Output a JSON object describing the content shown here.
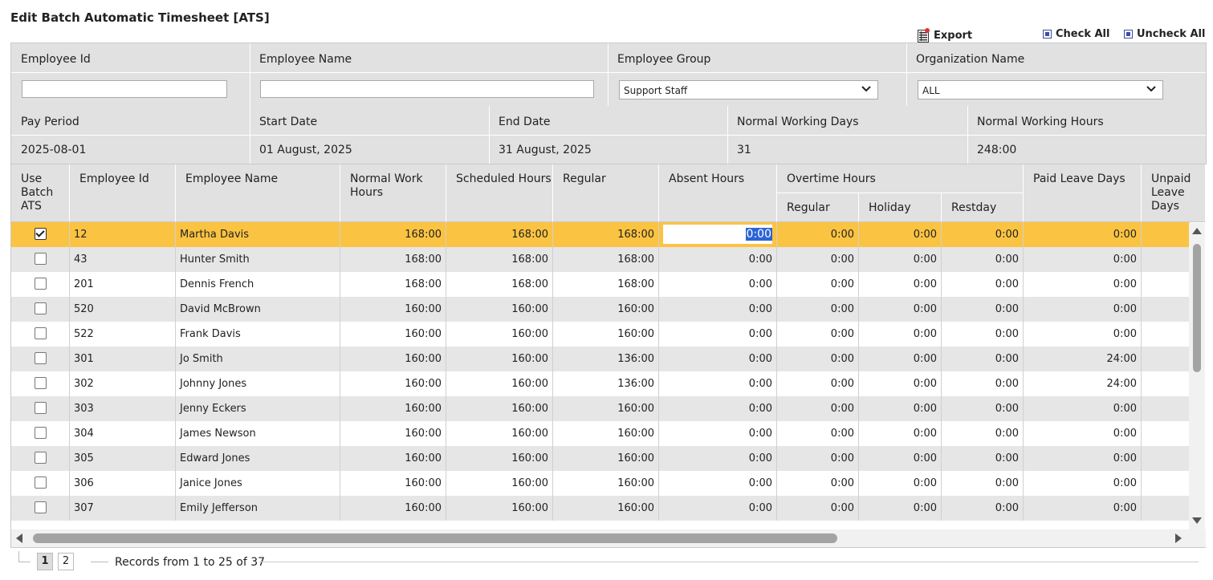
{
  "page": {
    "title": "Edit Batch Automatic Timesheet [ATS]"
  },
  "toolbar": {
    "export": "Export",
    "check_all": "Check All",
    "uncheck_all": "Uncheck All"
  },
  "filters": {
    "employee_id_label": "Employee Id",
    "employee_name_label": "Employee Name",
    "employee_group_label": "Employee Group",
    "employee_group_value": "Support Staff",
    "organization_label": "Organization Name",
    "organization_value": "ALL"
  },
  "period": {
    "pay_period_label": "Pay Period",
    "pay_period_value": "2025-08-01",
    "start_label": "Start Date",
    "start_value": "01 August, 2025",
    "end_label": "End Date",
    "end_value": "31 August, 2025",
    "days_label": "Normal Working Days",
    "days_value": "31",
    "hours_label": "Normal Working Hours",
    "hours_value": "248:00"
  },
  "grid": {
    "headers": {
      "use_batch": "Use Batch ATS",
      "emp_id": "Employee Id",
      "emp_name": "Employee Name",
      "normal": "Normal Work Hours",
      "scheduled": "Scheduled Hours",
      "regular": "Regular",
      "absent": "Absent Hours",
      "overtime": "Overtime Hours",
      "ot_regular": "Regular",
      "ot_holiday": "Holiday",
      "ot_restday": "Restday",
      "paid_leave": "Paid Leave Days",
      "unpaid_leave": "Unpaid Leave Days"
    },
    "rows": [
      {
        "checked": true,
        "id": "12",
        "name": "Martha Davis",
        "normal": "168:00",
        "sched": "168:00",
        "regular": "168:00",
        "absent": "0:00",
        "otr": "0:00",
        "oth": "0:00",
        "otd": "0:00",
        "paid": "0:00"
      },
      {
        "checked": false,
        "id": "43",
        "name": "Hunter Smith",
        "normal": "168:00",
        "sched": "168:00",
        "regular": "168:00",
        "absent": "0:00",
        "otr": "0:00",
        "oth": "0:00",
        "otd": "0:00",
        "paid": "0:00"
      },
      {
        "checked": false,
        "id": "201",
        "name": "Dennis French",
        "normal": "168:00",
        "sched": "168:00",
        "regular": "168:00",
        "absent": "0:00",
        "otr": "0:00",
        "oth": "0:00",
        "otd": "0:00",
        "paid": "0:00"
      },
      {
        "checked": false,
        "id": "520",
        "name": "David McBrown",
        "normal": "160:00",
        "sched": "160:00",
        "regular": "160:00",
        "absent": "0:00",
        "otr": "0:00",
        "oth": "0:00",
        "otd": "0:00",
        "paid": "0:00"
      },
      {
        "checked": false,
        "id": "522",
        "name": "Frank Davis",
        "normal": "160:00",
        "sched": "160:00",
        "regular": "160:00",
        "absent": "0:00",
        "otr": "0:00",
        "oth": "0:00",
        "otd": "0:00",
        "paid": "0:00"
      },
      {
        "checked": false,
        "id": "301",
        "name": "Jo Smith",
        "normal": "160:00",
        "sched": "160:00",
        "regular": "136:00",
        "absent": "0:00",
        "otr": "0:00",
        "oth": "0:00",
        "otd": "0:00",
        "paid": "24:00"
      },
      {
        "checked": false,
        "id": "302",
        "name": "Johnny Jones",
        "normal": "160:00",
        "sched": "160:00",
        "regular": "136:00",
        "absent": "0:00",
        "otr": "0:00",
        "oth": "0:00",
        "otd": "0:00",
        "paid": "24:00"
      },
      {
        "checked": false,
        "id": "303",
        "name": "Jenny Eckers",
        "normal": "160:00",
        "sched": "160:00",
        "regular": "160:00",
        "absent": "0:00",
        "otr": "0:00",
        "oth": "0:00",
        "otd": "0:00",
        "paid": "0:00"
      },
      {
        "checked": false,
        "id": "304",
        "name": "James Newson",
        "normal": "160:00",
        "sched": "160:00",
        "regular": "160:00",
        "absent": "0:00",
        "otr": "0:00",
        "oth": "0:00",
        "otd": "0:00",
        "paid": "0:00"
      },
      {
        "checked": false,
        "id": "305",
        "name": "Edward Jones",
        "normal": "160:00",
        "sched": "160:00",
        "regular": "160:00",
        "absent": "0:00",
        "otr": "0:00",
        "oth": "0:00",
        "otd": "0:00",
        "paid": "0:00"
      },
      {
        "checked": false,
        "id": "306",
        "name": "Janice Jones",
        "normal": "160:00",
        "sched": "160:00",
        "regular": "160:00",
        "absent": "0:00",
        "otr": "0:00",
        "oth": "0:00",
        "otd": "0:00",
        "paid": "0:00"
      },
      {
        "checked": false,
        "id": "307",
        "name": "Emily Jefferson",
        "normal": "160:00",
        "sched": "160:00",
        "regular": "160:00",
        "absent": "0:00",
        "otr": "0:00",
        "oth": "0:00",
        "otd": "0:00",
        "paid": "0:00"
      }
    ],
    "editing_value": "0:00"
  },
  "pager": {
    "pages": [
      "1",
      "2"
    ],
    "info": "Records from 1 to 25 of 37"
  },
  "colors": {
    "selected_row": "#fbc342",
    "alt_row": "#e6e6e6",
    "header_bg": "#e1e1e1"
  }
}
